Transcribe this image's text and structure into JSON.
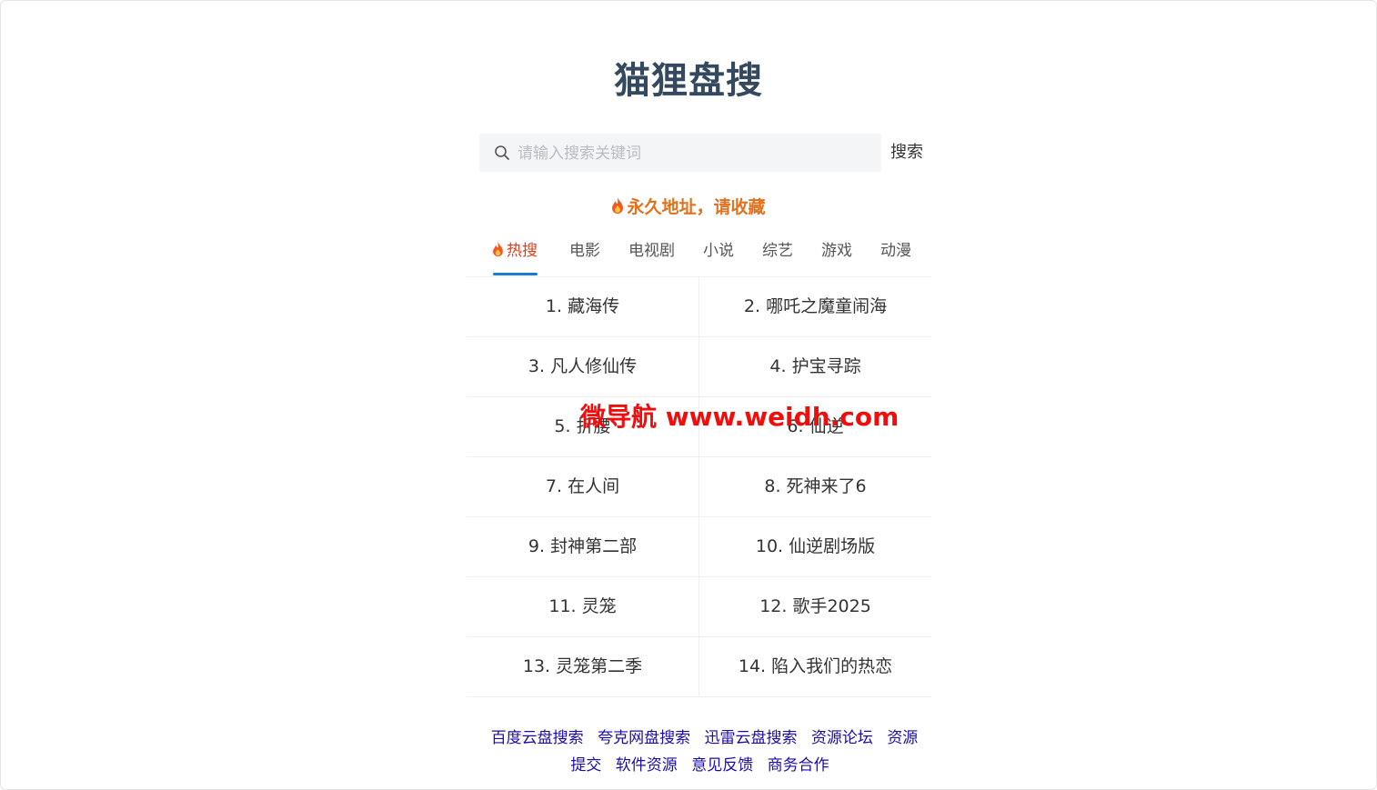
{
  "site": {
    "title": "猫狸盘搜"
  },
  "search": {
    "placeholder": "请输入搜索关键词",
    "value": "",
    "button_label": "搜索"
  },
  "notice": {
    "text": "永久地址，请收藏"
  },
  "tabs": [
    {
      "label": "热搜",
      "active": true
    },
    {
      "label": "电影",
      "active": false
    },
    {
      "label": "电视剧",
      "active": false
    },
    {
      "label": "小说",
      "active": false
    },
    {
      "label": "综艺",
      "active": false
    },
    {
      "label": "游戏",
      "active": false
    },
    {
      "label": "动漫",
      "active": false
    }
  ],
  "hot_list": [
    "1. 藏海传",
    "2. 哪吒之魔童闹海",
    "3. 凡人修仙传",
    "4. 护宝寻踪",
    "5. 折腰",
    "6. 仙逆",
    "7. 在人间",
    "8. 死神来了6",
    "9. 封神第二部",
    "10. 仙逆剧场版",
    "11. 灵笼",
    "12. 歌手2025",
    "13. 灵笼第二季",
    "14. 陷入我们的热恋"
  ],
  "footer_links": [
    "百度云盘搜索",
    "夸克网盘搜索",
    "迅雷云盘搜索",
    "资源论坛",
    "资源提交",
    "软件资源",
    "意见反馈",
    "商务合作"
  ],
  "watermark": {
    "text": "微导航 www.weidh.com"
  },
  "colors": {
    "title": "#34495e",
    "notice": "#e2711d",
    "active_tab": "#e23d1b",
    "tab_indicator": "#1a7bd4",
    "link": "#1a0dab",
    "watermark": "#f20d0d"
  }
}
